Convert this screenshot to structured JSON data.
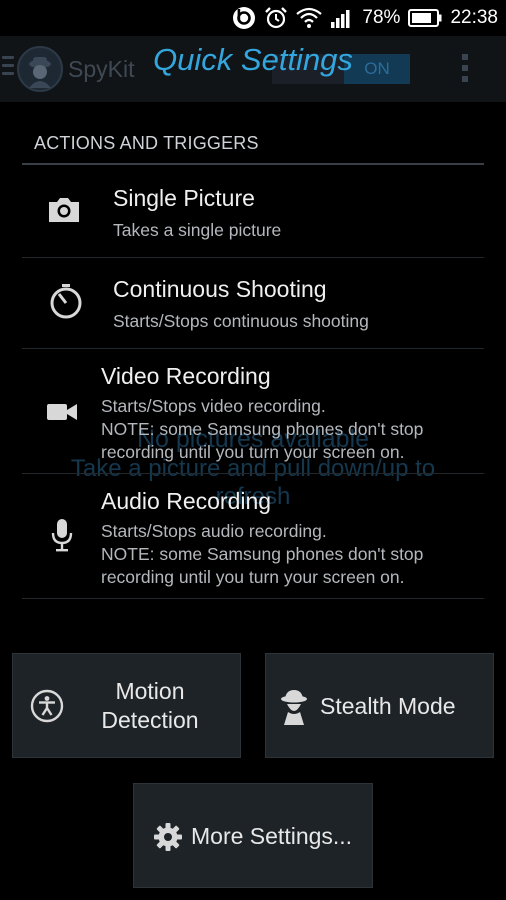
{
  "status_bar": {
    "battery_percent": "78%",
    "time": "22:38"
  },
  "app_bar": {
    "app_name": "SpyKit",
    "toggle_label": "ON"
  },
  "overlay": {
    "title": "Quick Settings",
    "section_title": "ACTIONS AND TRIGGERS",
    "items": [
      {
        "title": "Single Picture",
        "subtitle": "Takes a single picture",
        "icon": "camera-icon"
      },
      {
        "title": "Continuous Shooting",
        "subtitle": "Starts/Stops continuous shooting",
        "icon": "timer-icon"
      },
      {
        "title": "Video Recording",
        "subtitle_line1": "Starts/Stops video recording.",
        "subtitle_line2": "NOTE: some Samsung phones don't stop",
        "subtitle_line3": "recording until you turn your screen on.",
        "icon": "video-camera-icon"
      },
      {
        "title": "Audio Recording",
        "subtitle_line1": "Starts/Stops audio recording.",
        "subtitle_line2": "NOTE: some Samsung phones don't stop",
        "subtitle_line3": "recording until you turn your screen on.",
        "icon": "microphone-icon"
      }
    ],
    "buttons": {
      "motion_line1": "Motion",
      "motion_line2": "Detection",
      "stealth": "Stealth Mode",
      "more_settings": "More Settings..."
    }
  },
  "background": {
    "empty_line1": "No pictures available",
    "empty_line2": "Take a picture and pull down/up to refresh"
  },
  "colors": {
    "accent": "#33a6de",
    "background": "#000000",
    "button": "#1e2327"
  }
}
